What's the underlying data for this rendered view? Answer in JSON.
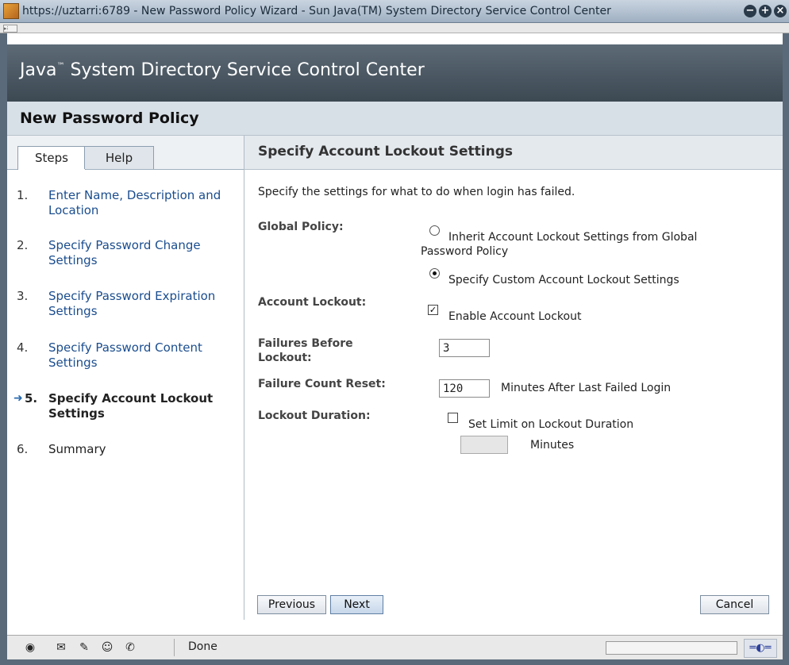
{
  "window": {
    "title": "https://uztarri:6789 - New Password Policy Wizard - Sun Java(TM) System Directory Service Control Center"
  },
  "masthead": {
    "title_pre": "Java",
    "tm": "™",
    "title_post": " System Directory Service Control Center"
  },
  "page": {
    "title": "New Password Policy"
  },
  "tabs": [
    {
      "label": "Steps"
    },
    {
      "label": "Help"
    }
  ],
  "steps": [
    {
      "num": "1.",
      "label": "Enter Name, Description and Location"
    },
    {
      "num": "2.",
      "label": "Specify Password Change Settings"
    },
    {
      "num": "3.",
      "label": "Specify Password Expiration Settings"
    },
    {
      "num": "4.",
      "label": "Specify Password Content Settings"
    },
    {
      "num": "5.",
      "label": "Specify Account Lockout Settings"
    },
    {
      "num": "6.",
      "label": "Summary"
    }
  ],
  "current_arrow": "➜",
  "main": {
    "heading": "Specify Account Lockout Settings",
    "instructions": "Specify the settings for what to do when login has failed.",
    "global_policy": {
      "label": "Global Policy:",
      "opt_inherit_line1": "Inherit Account Lockout Settings from Global",
      "opt_inherit_line2": "Password Policy",
      "opt_custom": "Specify Custom Account Lockout Settings",
      "selected": "custom"
    },
    "account_lockout": {
      "label": "Account Lockout:",
      "option": "Enable Account Lockout",
      "checked_mark": "✓"
    },
    "failures": {
      "label_line1": "Failures Before",
      "label_line2": "Lockout:",
      "value": "3"
    },
    "reset": {
      "label": "Failure Count Reset:",
      "value": "120",
      "suffix": "Minutes After Last Failed Login"
    },
    "duration": {
      "label": "Lockout Duration:",
      "option": "Set Limit on Lockout Duration",
      "value": "",
      "suffix": "Minutes"
    }
  },
  "buttons": {
    "previous": "Previous",
    "next": "Next",
    "cancel": "Cancel"
  },
  "status": {
    "text": "Done"
  },
  "colors": {
    "masthead": "#4a5762",
    "link": "#1a4d8f",
    "accent_arrow": "#2a6bb0"
  }
}
